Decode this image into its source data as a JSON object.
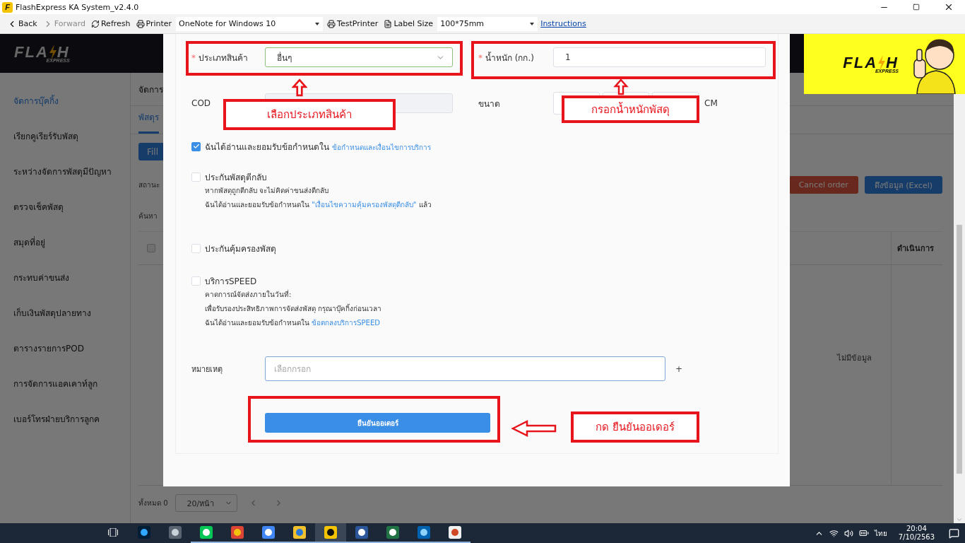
{
  "window": {
    "icon_letter": "F",
    "title": "FlashExpress KA System_v2.4.0"
  },
  "toolbar": {
    "back": {
      "label": "Back",
      "disabled": false
    },
    "forward": {
      "label": "Forward",
      "disabled": true
    },
    "refresh": {
      "label": "Refresh"
    },
    "printer": {
      "label": "Printer",
      "value": "OneNote for Windows 10"
    },
    "test_printer": {
      "label": "TestPrinter"
    },
    "label_size": {
      "label": "Label Size",
      "value": "100*75mm"
    },
    "instructions": {
      "label": "Instructions"
    }
  },
  "header": {
    "logo": {
      "left": "FLA",
      "right": "H",
      "sub": "EXPRESS"
    }
  },
  "banner": {
    "logo": {
      "left": "FLA",
      "right": "H",
      "sub": "EXPRESS"
    }
  },
  "sidebar": {
    "items": [
      {
        "label": "จัดการบุ๊คกิ้ง",
        "selected": true
      },
      {
        "label": "เรียกคูเรียร์รับพัสดุ",
        "selected": false
      },
      {
        "label": "ระหว่างจัดการพัสดุมีปัญหา",
        "selected": false
      },
      {
        "label": "ตรวจเช็คพัสดุ",
        "selected": false
      },
      {
        "label": "สมุดที่อยู่",
        "selected": false
      },
      {
        "label": "กระทบค่าขนส่ง",
        "selected": false
      },
      {
        "label": "เก็บเงินพัสดุปลายทาง",
        "selected": false
      },
      {
        "label": "ตารางรายการPOD",
        "selected": false
      },
      {
        "label": "การจัดการแอคเคาท์ลูก",
        "selected": false
      },
      {
        "label": "เบอร์โทรฝ่ายบริการลูกค",
        "selected": false
      }
    ]
  },
  "main": {
    "breadcrumb": "จัดการ",
    "tabs": [
      {
        "label": "พัสดุร",
        "selected": true
      }
    ],
    "fill_button": "Fill",
    "status_label": "สถานะ",
    "search_label": "ค้นหา",
    "action_buttons": [
      {
        "label": "Cancel order",
        "kind": "danger"
      },
      {
        "label": "ดึงข้อมูล (Excel)",
        "kind": "primary"
      }
    ],
    "table": {
      "select_all": {
        "disabled": true
      },
      "columns": [
        {
          "label": "ดำเนินการ"
        }
      ],
      "empty_text": "ไม่มีข้อมูล"
    },
    "pagination": {
      "total": "ทั้งหมด 0",
      "page_size": "20/หน้า"
    }
  },
  "dialog": {
    "product_type": {
      "mark": "*",
      "label": "ประเภทสินค้า",
      "value": "อื่นๆ"
    },
    "weight": {
      "mark": "*",
      "label": "น้ำหนัก (กก.)",
      "value": "1"
    },
    "cod": {
      "label": "COD",
      "disabled": true
    },
    "size": {
      "label": "ขนาด",
      "unit": "CM"
    },
    "terms": {
      "checked": true,
      "text": "ฉันได้อ่านและยอมรับข้อกำหนดใน",
      "link": "ข้อกำหนดและเงื่อนไขการบริการ"
    },
    "options": [
      {
        "label": "ประกันพัสดุตีกลับ",
        "checked": false,
        "lines": [
          {
            "text": "หากพัสดุถูกตีกลับ จะไม่คิดค่าขนส่งตีกลับ"
          },
          {
            "text": "ฉันได้อ่านและยอมรับข้อกำหนดใน ",
            "link": "\"เงื่อนไขความคุ้มครองพัสดุตีกลับ\"",
            "suffix": " แล้ว"
          }
        ]
      },
      {
        "label": "ประกันคุ้มครองพัสดุ",
        "checked": false
      },
      {
        "label": "บริการSPEED",
        "checked": false,
        "lines": [
          {
            "text": "คาดการณ์จัดส่งภายในวันที่:"
          },
          {
            "text": "เพื่อรับรองประสิทธิภาพการจัดส่งพัสดุ กรุณาบุ๊คกิ้งก่อนเวลา"
          },
          {
            "text": "ฉันได้อ่านและยอมรับข้อกำหนดใน ",
            "link": "ข้อตกลงบริการSPEED"
          }
        ]
      }
    ],
    "note": {
      "label": "หมายเหตุ",
      "placeholder": "เลือกกรอก",
      "add": "+"
    },
    "submit": {
      "label": "ยืนยันออเดอร์"
    }
  },
  "annotations": [
    {
      "label": "เลือกประเภทสินค้า"
    },
    {
      "label": "กรอกน้ำหนักพัสดุ"
    },
    {
      "label": "กด ยืนยันออเดอร์"
    }
  ],
  "taskbar": {
    "language": "ไทย",
    "time": "20:04",
    "date": "7/10/2563"
  }
}
